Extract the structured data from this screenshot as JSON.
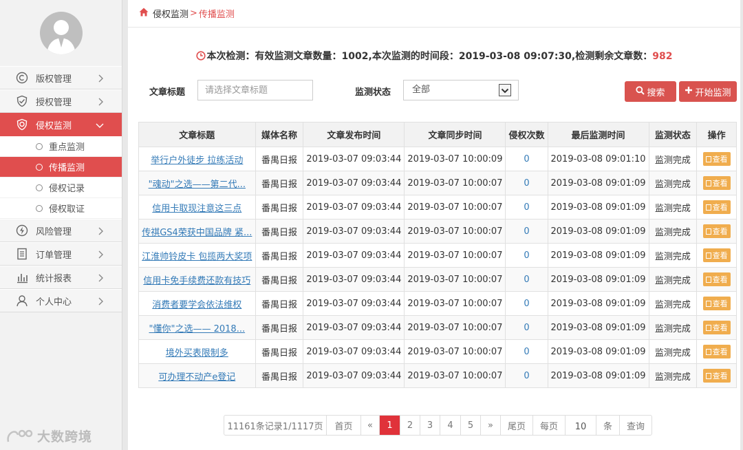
{
  "sidebar": {
    "items": [
      {
        "label": "版权管理",
        "icon": "copyright-icon"
      },
      {
        "label": "授权管理",
        "icon": "shield-check-icon"
      },
      {
        "label": "侵权监测",
        "icon": "target-icon"
      },
      {
        "label": "风险管理",
        "icon": "lightning-icon"
      },
      {
        "label": "订单管理",
        "icon": "list-icon"
      },
      {
        "label": "统计报表",
        "icon": "bar-chart-icon"
      },
      {
        "label": "个人中心",
        "icon": "user-icon"
      }
    ],
    "submenu": [
      "重点监测",
      "传播监测",
      "侵权记录",
      "侵权取证"
    ],
    "watermark": "大数跨境"
  },
  "breadcrumb": {
    "parent": "侵权监测",
    "separator": ">",
    "current": "传播监测"
  },
  "status": {
    "prefix": "本次检测：有效监测文章数量：1002,本次监测的时间段：2019-03-08 09:07:30,检测剩余文章数：",
    "remaining": "982"
  },
  "filters": {
    "title_label": "文章标题",
    "title_placeholder": "请选择文章标题",
    "status_label": "监测状态",
    "status_value": "全部",
    "search_label": "搜索",
    "start_label": "开始监测"
  },
  "table": {
    "headers": [
      "文章标题",
      "媒体名称",
      "文章发布时间",
      "文章同步时间",
      "侵权次数",
      "最后监测时间",
      "监测状态",
      "操作"
    ],
    "action_label": "查看",
    "rows": [
      {
        "title": "举行户外徒步 拉练活动",
        "media": "番禺日报",
        "published": "2019-03-07 09:03:44",
        "synced": "2019-03-07 10:00:09",
        "count": "0",
        "last": "2019-03-08 09:01:10",
        "status": "监测完成"
      },
      {
        "title": "\"魂动\"之选——第二代...",
        "media": "番禺日报",
        "published": "2019-03-07 09:03:44",
        "synced": "2019-03-07 10:00:07",
        "count": "0",
        "last": "2019-03-08 09:01:09",
        "status": "监测完成"
      },
      {
        "title": "信用卡取现注意这三点",
        "media": "番禺日报",
        "published": "2019-03-07 09:03:44",
        "synced": "2019-03-07 10:00:07",
        "count": "0",
        "last": "2019-03-08 09:01:09",
        "status": "监测完成"
      },
      {
        "title": "传祺GS4荣获中国品牌 紧...",
        "media": "番禺日报",
        "published": "2019-03-07 09:03:44",
        "synced": "2019-03-07 10:00:07",
        "count": "0",
        "last": "2019-03-08 09:01:09",
        "status": "监测完成"
      },
      {
        "title": "江淮帅铃皮卡 包揽两大奖项",
        "media": "番禺日报",
        "published": "2019-03-07 09:03:44",
        "synced": "2019-03-07 10:00:07",
        "count": "0",
        "last": "2019-03-08 09:01:09",
        "status": "监测完成"
      },
      {
        "title": "信用卡免手续费还款有技巧",
        "media": "番禺日报",
        "published": "2019-03-07 09:03:44",
        "synced": "2019-03-07 10:00:07",
        "count": "0",
        "last": "2019-03-08 09:01:09",
        "status": "监测完成"
      },
      {
        "title": "消费者要学会依法维权",
        "media": "番禺日报",
        "published": "2019-03-07 09:03:44",
        "synced": "2019-03-07 10:00:07",
        "count": "0",
        "last": "2019-03-08 09:01:09",
        "status": "监测完成"
      },
      {
        "title": "\"懂你\"之选—— 2018...",
        "media": "番禺日报",
        "published": "2019-03-07 09:03:44",
        "synced": "2019-03-07 10:00:07",
        "count": "0",
        "last": "2019-03-08 09:01:09",
        "status": "监测完成"
      },
      {
        "title": "境外买表限制多",
        "media": "番禺日报",
        "published": "2019-03-07 09:03:44",
        "synced": "2019-03-07 10:00:07",
        "count": "0",
        "last": "2019-03-08 09:01:09",
        "status": "监测完成"
      },
      {
        "title": "可办理不动产e登记",
        "media": "番禺日报",
        "published": "2019-03-07 09:03:44",
        "synced": "2019-03-07 10:00:07",
        "count": "0",
        "last": "2019-03-08 09:01:09",
        "status": "监测完成"
      }
    ]
  },
  "pagination": {
    "summary": "11161条记录1/1117页",
    "first": "首页",
    "prev": "«",
    "pages": [
      "1",
      "2",
      "3",
      "4",
      "5"
    ],
    "next": "»",
    "last": "尾页",
    "per_page_label": "每页",
    "per_page_value": "10",
    "unit": "条",
    "query": "查询"
  },
  "colors": {
    "accent": "#e04e4e",
    "link": "#337ab7",
    "action": "#f0ad4e"
  }
}
